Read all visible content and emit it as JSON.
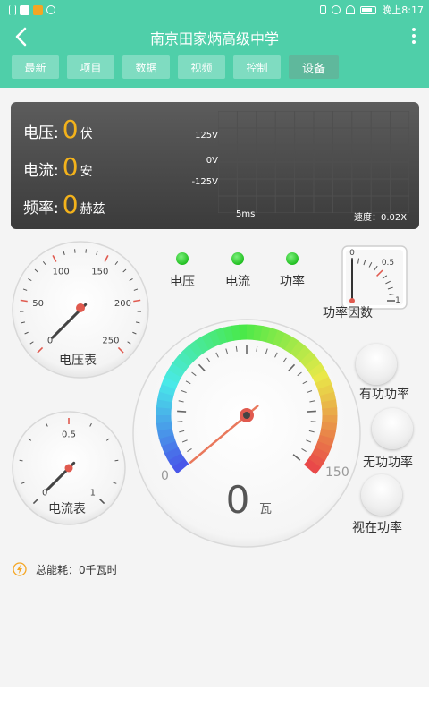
{
  "status_bar": {
    "time": "晚上8:17"
  },
  "header": {
    "title": "南京田家炳高级中学",
    "tabs": [
      {
        "label": "最新"
      },
      {
        "label": "项目"
      },
      {
        "label": "数据"
      },
      {
        "label": "视频"
      },
      {
        "label": "控制"
      },
      {
        "label": "设备"
      }
    ],
    "active_tab": "设备"
  },
  "panel": {
    "readings": [
      {
        "label": "电压:",
        "value": "0",
        "unit": "伏"
      },
      {
        "label": "电流:",
        "value": "0",
        "unit": "安"
      },
      {
        "label": "频率:",
        "value": "0",
        "unit": "赫兹"
      }
    ],
    "scope": {
      "y_labels": [
        "125V",
        "0V",
        "-125V"
      ],
      "time_label": "5ms",
      "speed_label": "速度：0.02X"
    }
  },
  "voltmeter": {
    "label": "电压表",
    "min": 0,
    "max": 250,
    "value": 0,
    "tick_labels": [
      "0",
      "50",
      "100",
      "150",
      "200",
      "250"
    ]
  },
  "ammeter": {
    "label": "电流表",
    "min": 0,
    "max": 1,
    "value": 0,
    "tick_labels": [
      "0",
      "0.5",
      "1"
    ]
  },
  "indicators": [
    {
      "label": "电压",
      "color": "#22c022"
    },
    {
      "label": "电流",
      "color": "#22c022"
    },
    {
      "label": "功率",
      "color": "#22c022"
    }
  ],
  "power_factor": {
    "label": "功率因数",
    "min": 0,
    "max": 1,
    "value": 0,
    "tick_labels": [
      "0",
      "0.5",
      "1"
    ]
  },
  "power_gauge": {
    "min_label": "0",
    "max_label": "150",
    "value": 0,
    "value_text": "0",
    "unit": "瓦"
  },
  "power_buttons": [
    {
      "label": "有功功率"
    },
    {
      "label": "无功功率"
    },
    {
      "label": "视在功率"
    }
  ],
  "energy": {
    "text": "总能耗：0千瓦时"
  },
  "colors": {
    "header": "#4fcfa9",
    "reading_value": "#f3b21b",
    "needle": "#e9785c",
    "lamp": "#22c022"
  }
}
